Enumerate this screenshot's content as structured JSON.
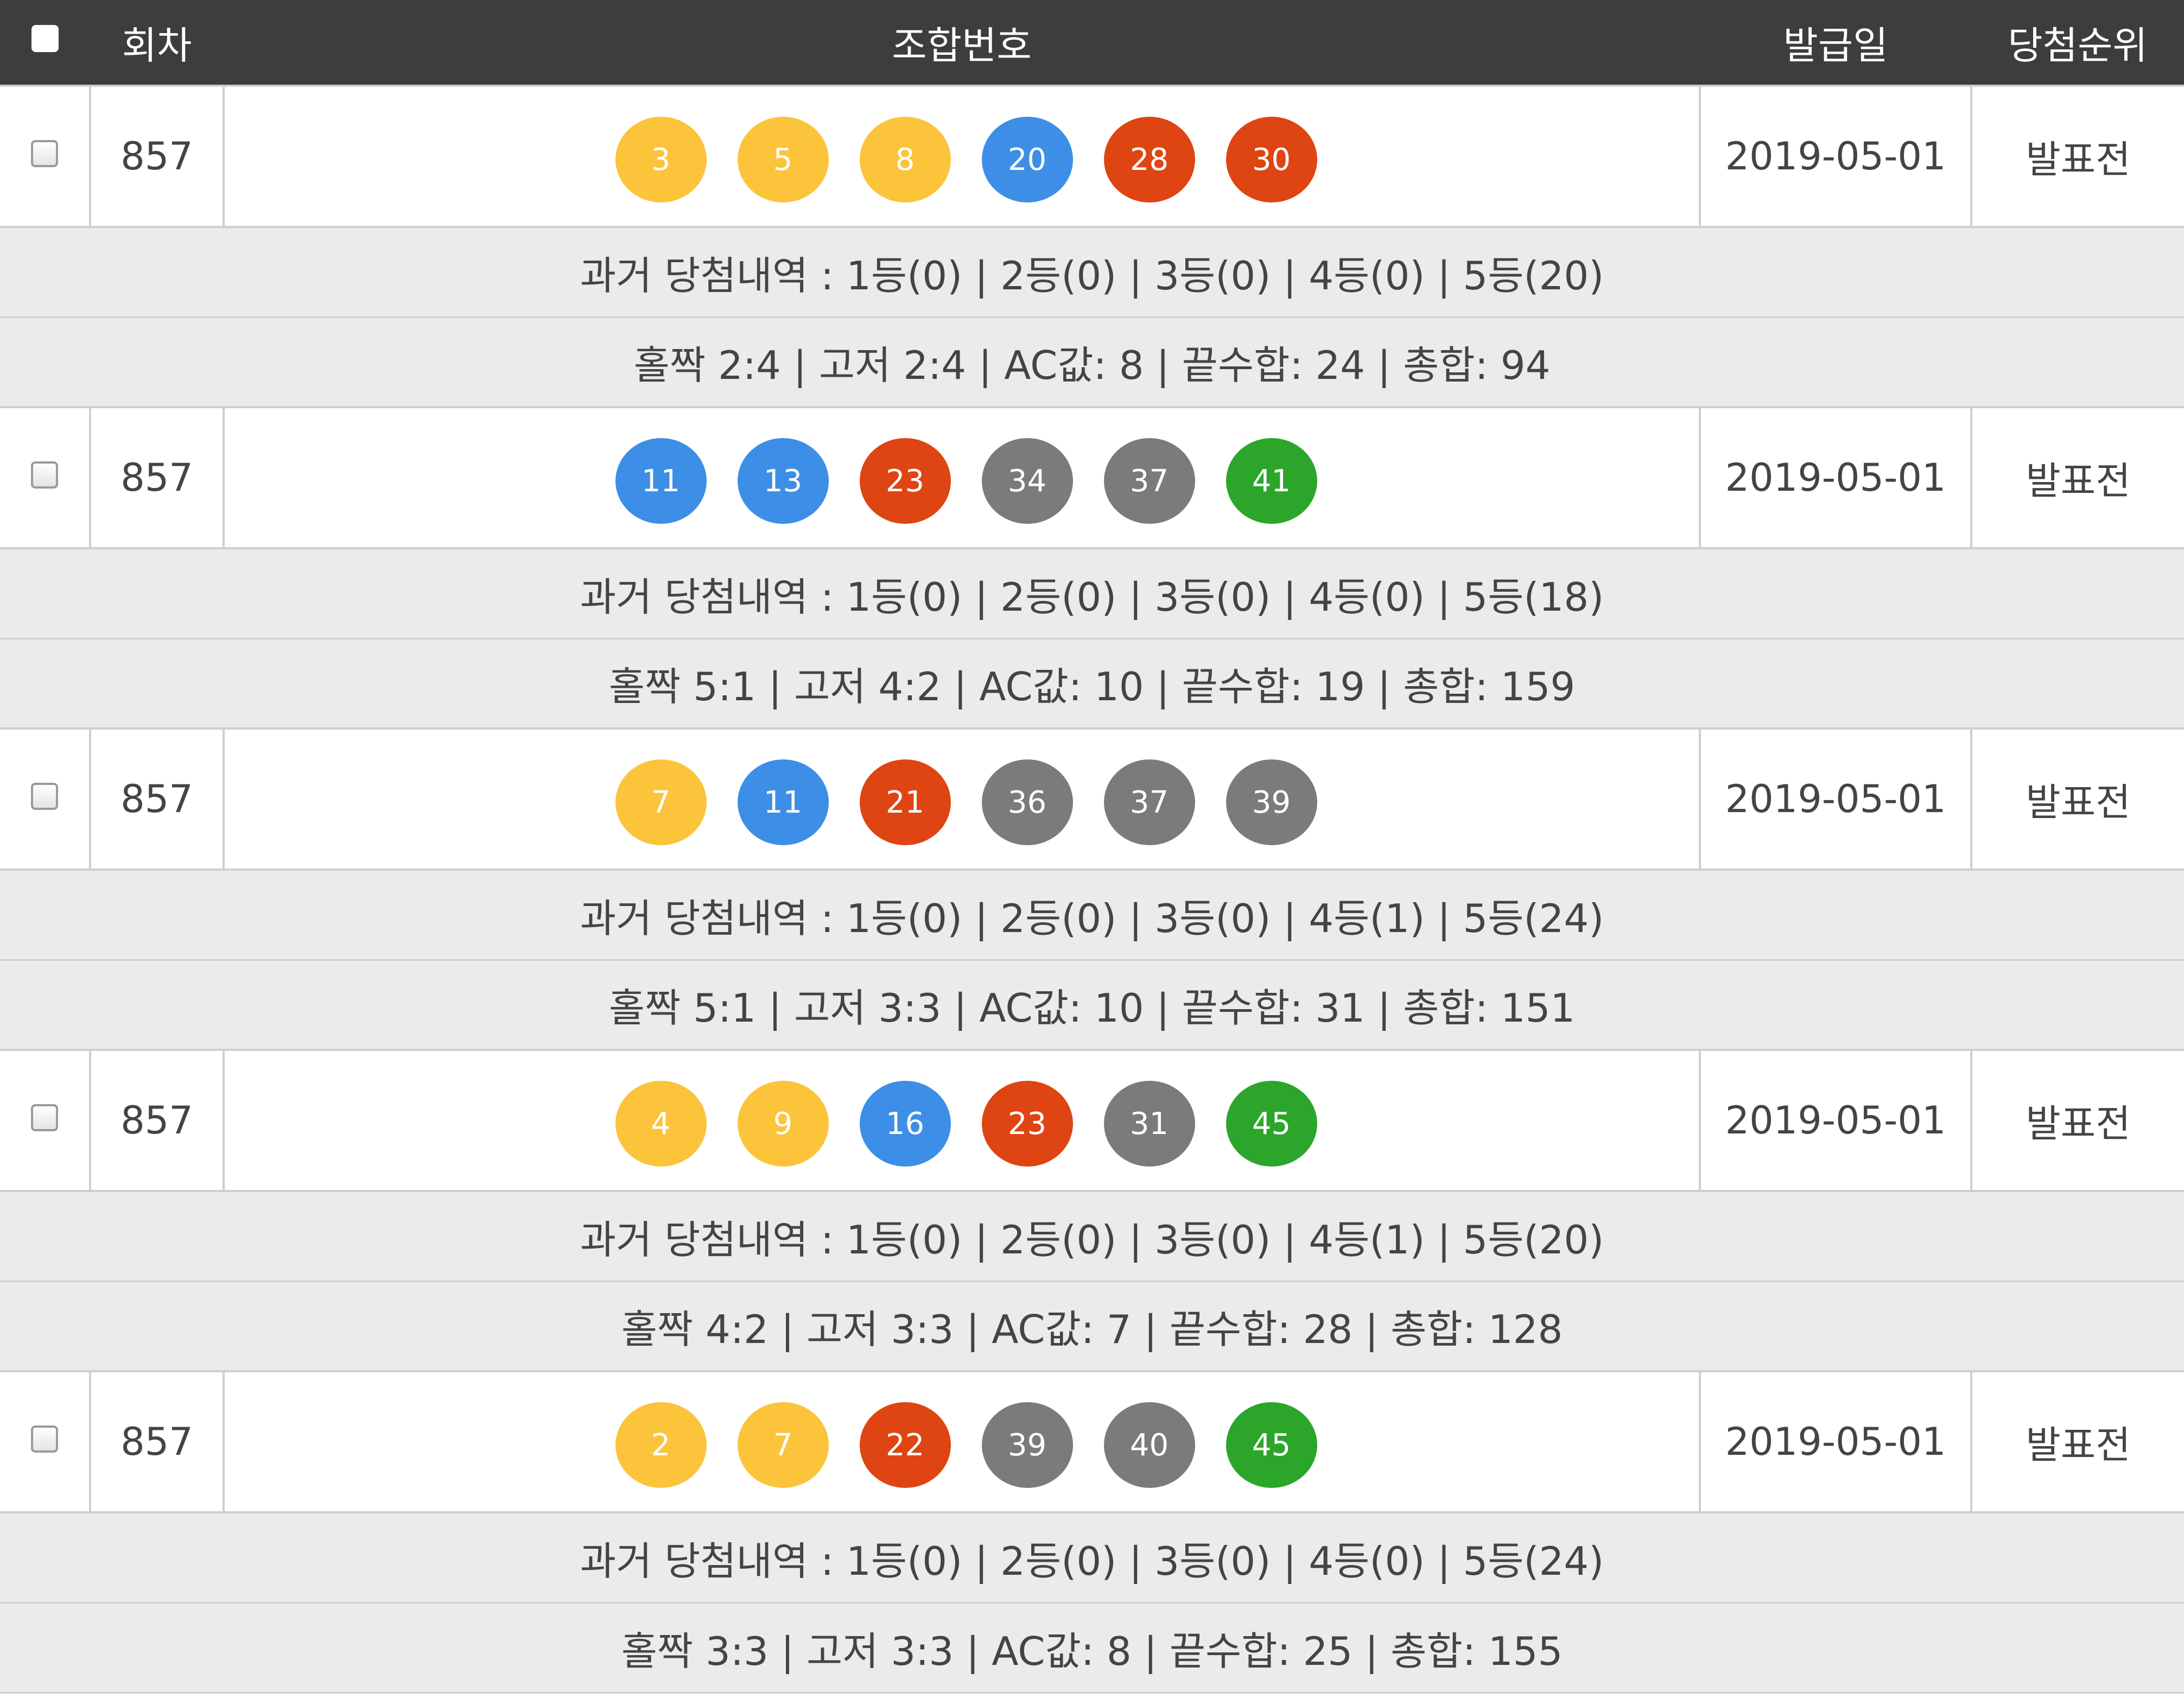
{
  "colors": {
    "header_bg": "#3d3d3d",
    "info_bg": "#ebebeb",
    "border": "#cfcfcf",
    "ball_yellow": "#fbc43b",
    "ball_blue": "#3d8ee6",
    "ball_red": "#de4512",
    "ball_gray": "#7b7b7b",
    "ball_green": "#2ca62a"
  },
  "header": {
    "select_all_icon": "checkbox-icon",
    "round_label": "회차",
    "numbers_label": "조합번호",
    "issue_date_label": "발급일",
    "rank_label": "당첨순위"
  },
  "rows": [
    {
      "round": "857",
      "balls": [
        "3",
        "5",
        "8",
        "20",
        "28",
        "30"
      ],
      "ball_colors": [
        "yellow",
        "yellow",
        "yellow",
        "blue",
        "red",
        "red"
      ],
      "issue_date": "2019-05-01",
      "rank": "발표전",
      "history": "과거 당첨내역 : 1등(0) | 2등(0) | 3등(0) | 4등(0) | 5등(20)",
      "stats": "홀짝 2:4 | 고저 2:4 | AC값: 8 | 끝수합: 24 | 총합: 94"
    },
    {
      "round": "857",
      "balls": [
        "11",
        "13",
        "23",
        "34",
        "37",
        "41"
      ],
      "ball_colors": [
        "blue",
        "blue",
        "red",
        "gray",
        "gray",
        "green"
      ],
      "issue_date": "2019-05-01",
      "rank": "발표전",
      "history": "과거 당첨내역 : 1등(0) | 2등(0) | 3등(0) | 4등(0) | 5등(18)",
      "stats": "홀짝 5:1 | 고저 4:2 | AC값: 10 | 끝수합: 19 | 총합: 159"
    },
    {
      "round": "857",
      "balls": [
        "7",
        "11",
        "21",
        "36",
        "37",
        "39"
      ],
      "ball_colors": [
        "yellow",
        "blue",
        "red",
        "gray",
        "gray",
        "gray"
      ],
      "issue_date": "2019-05-01",
      "rank": "발표전",
      "history": "과거 당첨내역 : 1등(0) | 2등(0) | 3등(0) | 4등(1) | 5등(24)",
      "stats": "홀짝 5:1 | 고저 3:3 | AC값: 10 | 끝수합: 31 | 총합: 151"
    },
    {
      "round": "857",
      "balls": [
        "4",
        "9",
        "16",
        "23",
        "31",
        "45"
      ],
      "ball_colors": [
        "yellow",
        "yellow",
        "blue",
        "red",
        "gray",
        "green"
      ],
      "issue_date": "2019-05-01",
      "rank": "발표전",
      "history": "과거 당첨내역 : 1등(0) | 2등(0) | 3등(0) | 4등(1) | 5등(20)",
      "stats": "홀짝 4:2 | 고저 3:3 | AC값: 7 | 끝수합: 28 | 총합: 128"
    },
    {
      "round": "857",
      "balls": [
        "2",
        "7",
        "22",
        "39",
        "40",
        "45"
      ],
      "ball_colors": [
        "yellow",
        "yellow",
        "red",
        "gray",
        "gray",
        "green"
      ],
      "issue_date": "2019-05-01",
      "rank": "발표전",
      "history": "과거 당첨내역 : 1등(0) | 2등(0) | 3등(0) | 4등(0) | 5등(24)",
      "stats": "홀짝 3:3 | 고저 3:3 | AC값: 8 | 끝수합: 25 | 총합: 155"
    }
  ]
}
